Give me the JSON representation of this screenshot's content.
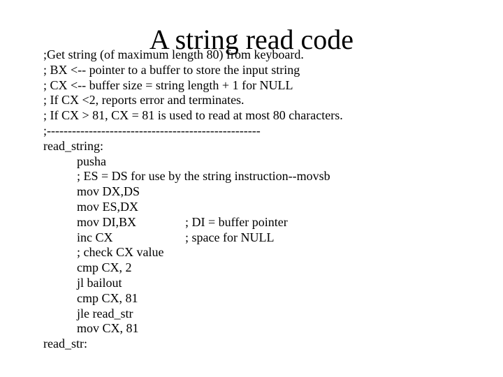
{
  "slide": {
    "title": "A string read code",
    "background_color": "#ffffff",
    "text_color": "#000000"
  },
  "code": {
    "lines": [
      {
        "indent": 0,
        "text": ";Get string (of maximum length 80) from keyboard.",
        "comment": ""
      },
      {
        "indent": 0,
        "text": "; BX <-- pointer to a buffer to store the input string",
        "comment": ""
      },
      {
        "indent": 0,
        "text": "; CX <-- buffer size = string length + 1 for NULL",
        "comment": ""
      },
      {
        "indent": 0,
        "text": "; If CX <2, reports error and terminates.",
        "comment": ""
      },
      {
        "indent": 0,
        "text": "; If CX > 81, CX = 81 is used to read at most 80 characters.",
        "comment": ""
      },
      {
        "indent": 0,
        "text": ";---------------------------------------------------",
        "comment": ""
      },
      {
        "indent": 0,
        "text": "read_string:",
        "comment": ""
      },
      {
        "indent": 1,
        "text": "pusha",
        "comment": ""
      },
      {
        "indent": 1,
        "text": "; ES = DS for use by the string instruction--movsb",
        "comment": ""
      },
      {
        "indent": 1,
        "text": "mov DX,DS",
        "comment": ""
      },
      {
        "indent": 1,
        "text": "mov ES,DX",
        "comment": ""
      },
      {
        "indent": 1,
        "text": "mov DI,BX",
        "comment": "; DI = buffer pointer"
      },
      {
        "indent": 1,
        "text": "inc CX",
        "comment": "; space for NULL"
      },
      {
        "indent": 1,
        "text": "; check CX value",
        "comment": ""
      },
      {
        "indent": 1,
        "text": "cmp CX, 2",
        "comment": ""
      },
      {
        "indent": 1,
        "text": "jl bailout",
        "comment": ""
      },
      {
        "indent": 1,
        "text": "cmp CX, 81",
        "comment": ""
      },
      {
        "indent": 1,
        "text": "jle read_str",
        "comment": ""
      },
      {
        "indent": 1,
        "text": "mov CX, 81",
        "comment": ""
      },
      {
        "indent": 0,
        "text": "read_str:",
        "comment": ""
      }
    ]
  }
}
